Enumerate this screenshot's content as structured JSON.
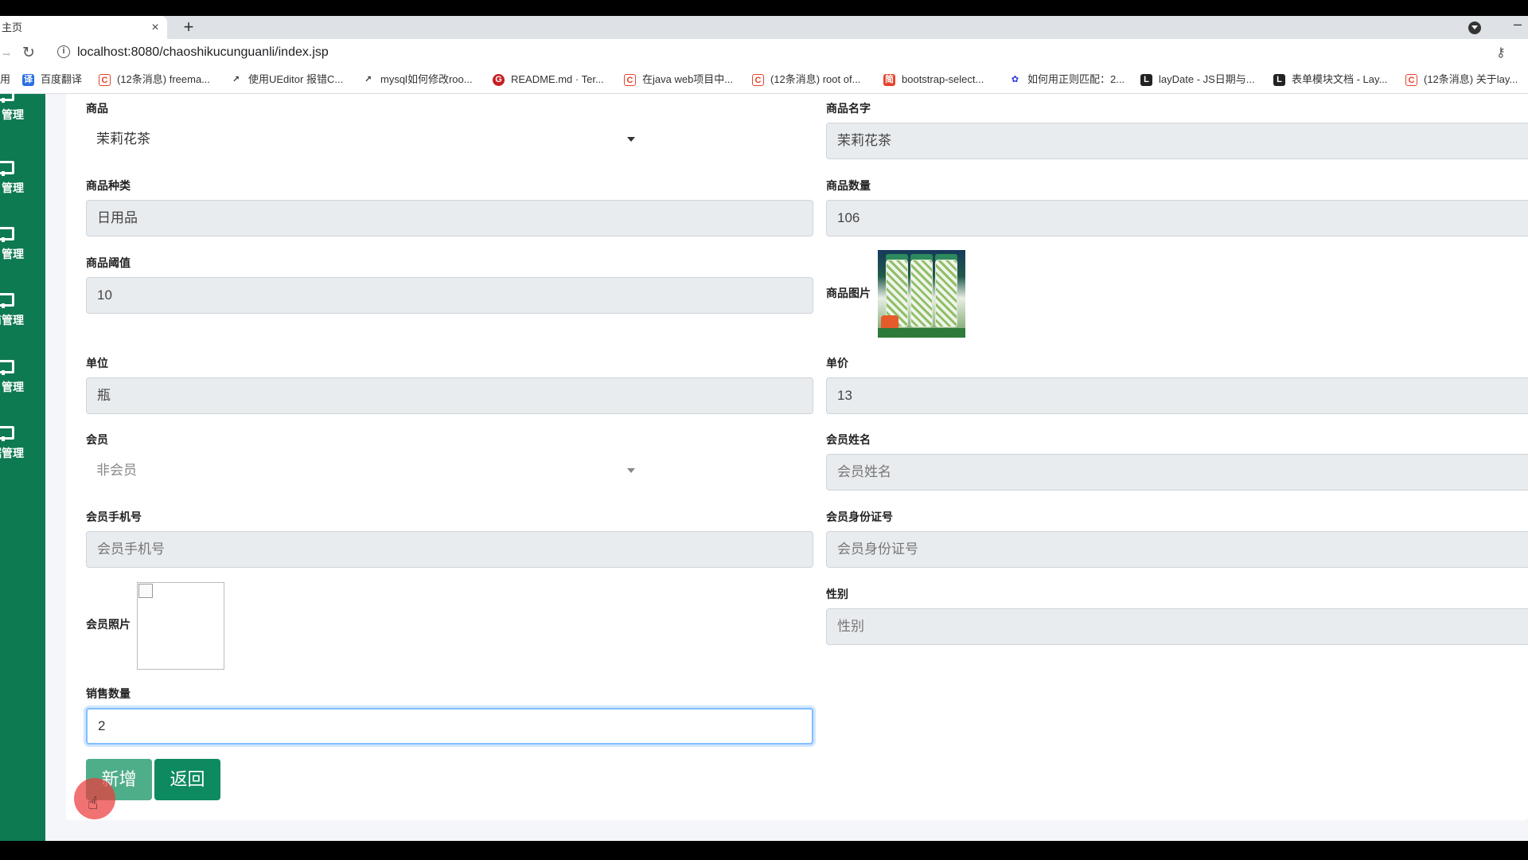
{
  "browser": {
    "tab_title": "主页",
    "close_glyph": "×",
    "new_tab_glyph": "+",
    "url": "localhost:8080/chaoshikucunguanli/index.jsp",
    "bookmarks": [
      {
        "label": "用",
        "icon": "apps-icon"
      },
      {
        "label": "百度翻译",
        "icon": "baidu-translate-icon"
      },
      {
        "label": "(12条消息) freema...",
        "icon": "csdn-icon"
      },
      {
        "label": "使用UEditor 报错C...",
        "icon": "link-icon"
      },
      {
        "label": "mysql如何修改roo...",
        "icon": "link-icon"
      },
      {
        "label": "README.md · Ter...",
        "icon": "gitee-icon"
      },
      {
        "label": "在java web项目中...",
        "icon": "csdn-icon"
      },
      {
        "label": "(12条消息) root of...",
        "icon": "csdn-icon"
      },
      {
        "label": "bootstrap-select...",
        "icon": "bookmark-icon"
      },
      {
        "label": "如何用正则匹配：2...",
        "icon": "baidu-icon"
      },
      {
        "label": "layDate - JS日期与...",
        "icon": "layui-icon"
      },
      {
        "label": "表单模块文档 - Lay...",
        "icon": "layui-icon"
      },
      {
        "label": "(12条消息) 关于lay...",
        "icon": "csdn-icon"
      }
    ]
  },
  "sidebar": {
    "items": [
      {
        "label": "管理"
      },
      {
        "label": "管理"
      },
      {
        "label": "管理"
      },
      {
        "label": "商管理"
      },
      {
        "label": "管理"
      },
      {
        "label": "据管理"
      }
    ]
  },
  "form": {
    "product_label": "商品",
    "product_selected": "茉莉花茶",
    "product_name_label": "商品名字",
    "product_name_value": "茉莉花茶",
    "category_label": "商品种类",
    "category_value": "日用品",
    "quantity_label": "商品数量",
    "quantity_value": "106",
    "threshold_label": "商品阈值",
    "threshold_value": "10",
    "image_label": "商品图片",
    "unit_label": "单位",
    "unit_value": "瓶",
    "price_label": "单价",
    "price_value": "13",
    "member_label": "会员",
    "member_selected": "非会员",
    "member_name_label": "会员姓名",
    "member_name_placeholder": "会员姓名",
    "member_phone_label": "会员手机号",
    "member_phone_placeholder": "会员手机号",
    "member_id_label": "会员身份证号",
    "member_id_placeholder": "会员身份证号",
    "member_photo_label": "会员照片",
    "gender_label": "性别",
    "gender_placeholder": "性别",
    "sales_qty_label": "销售数量",
    "sales_qty_value": "2"
  },
  "actions": {
    "add_label": "新增",
    "back_label": "返回"
  },
  "colors": {
    "sidebar_bg": "#0e7a52",
    "add_button": "#4fae8a",
    "back_button": "#0e8a60",
    "focus_border": "#80bdff"
  }
}
